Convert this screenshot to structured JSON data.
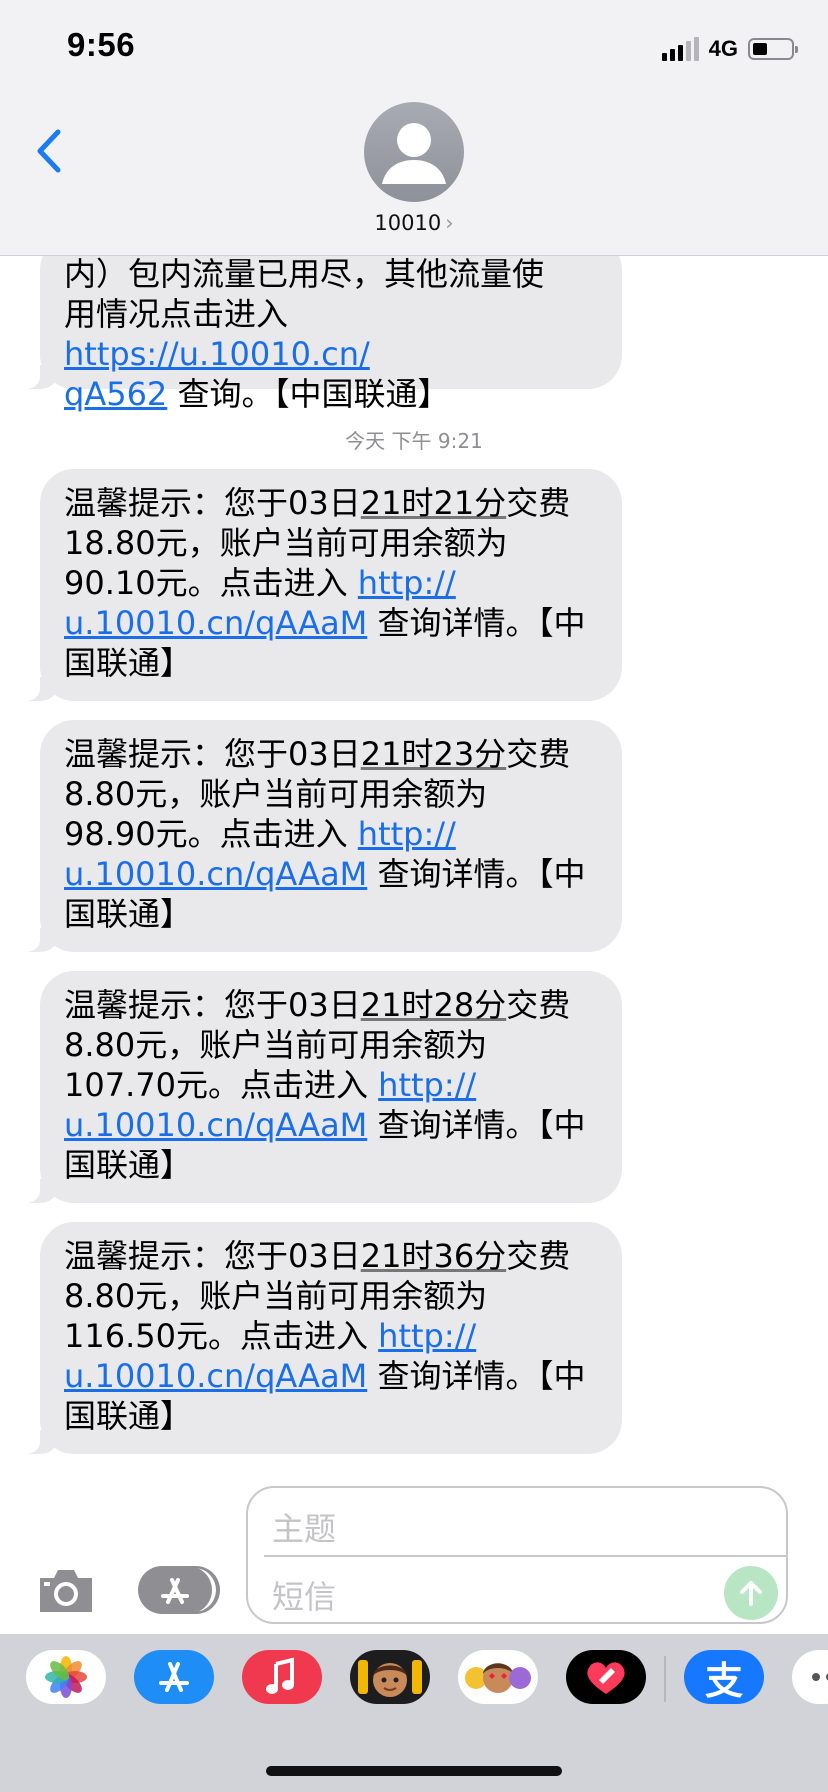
{
  "status_bar": {
    "time": "9:56",
    "network": "4G"
  },
  "header": {
    "contact_name": "10010",
    "contact_chevron": "›"
  },
  "messages": {
    "partial": {
      "line1": "内）包内流量已用尽，其他流量使",
      "line2_prefix": "用情况点击进入 ",
      "link_part1": "https://u.10010.cn/",
      "link_part2": "qA562",
      "line3_suffix": " 查询。【中国联通】"
    },
    "timestamp": "今天 下午 9:21",
    "items": [
      {
        "prefix": "温馨提示：您于03日",
        "time_text": "21时21分",
        "fee_line": "交费18.80元，账户当前可用余额为",
        "balance_line": "90.10元。点击进入 ",
        "link_part1": "http://",
        "link_part2": "u.10010.cn/qAAaM",
        "suffix": " 查询详情。【中国联通】"
      },
      {
        "prefix": "温馨提示：您于03日",
        "time_text": "21时23分",
        "fee_line": "交费8.80元，账户当前可用余额为",
        "balance_line": "98.90元。点击进入 ",
        "link_part1": "http://",
        "link_part2": "u.10010.cn/qAAaM",
        "suffix": " 查询详情。【中国联通】"
      },
      {
        "prefix": "温馨提示：您于03日",
        "time_text": "21时28分",
        "fee_line": "交费8.80元，账户当前可用余额为",
        "balance_line": "107.70元。点击进入 ",
        "link_part1": "http://",
        "link_part2": "u.10010.cn/qAAaM",
        "suffix": " 查询详情。【中国联通】"
      },
      {
        "prefix": "温馨提示：您于03日",
        "time_text": "21时36分",
        "fee_line": "交费8.80元，账户当前可用余额为",
        "balance_line": "116.50元。点击进入 ",
        "link_part1": "http://",
        "link_part2": "u.10010.cn/qAAaM",
        "suffix": " 查询详情。【中国联通】"
      }
    ]
  },
  "compose": {
    "subject_placeholder": "主题",
    "body_placeholder": "短信"
  },
  "app_drawer": {
    "icons": [
      "photos-icon",
      "app-store-icon",
      "music-icon",
      "memoji-icon",
      "animoji-icon",
      "digital-touch-icon",
      "alipay-icon",
      "more-icon"
    ],
    "alipay_glyph": "支"
  },
  "colors": {
    "link": "#1a6ee8",
    "bubble": "#e9e9eb",
    "header": "#f2f2f4",
    "send": "#b8e6c4",
    "accent": "#1a7cf0"
  }
}
